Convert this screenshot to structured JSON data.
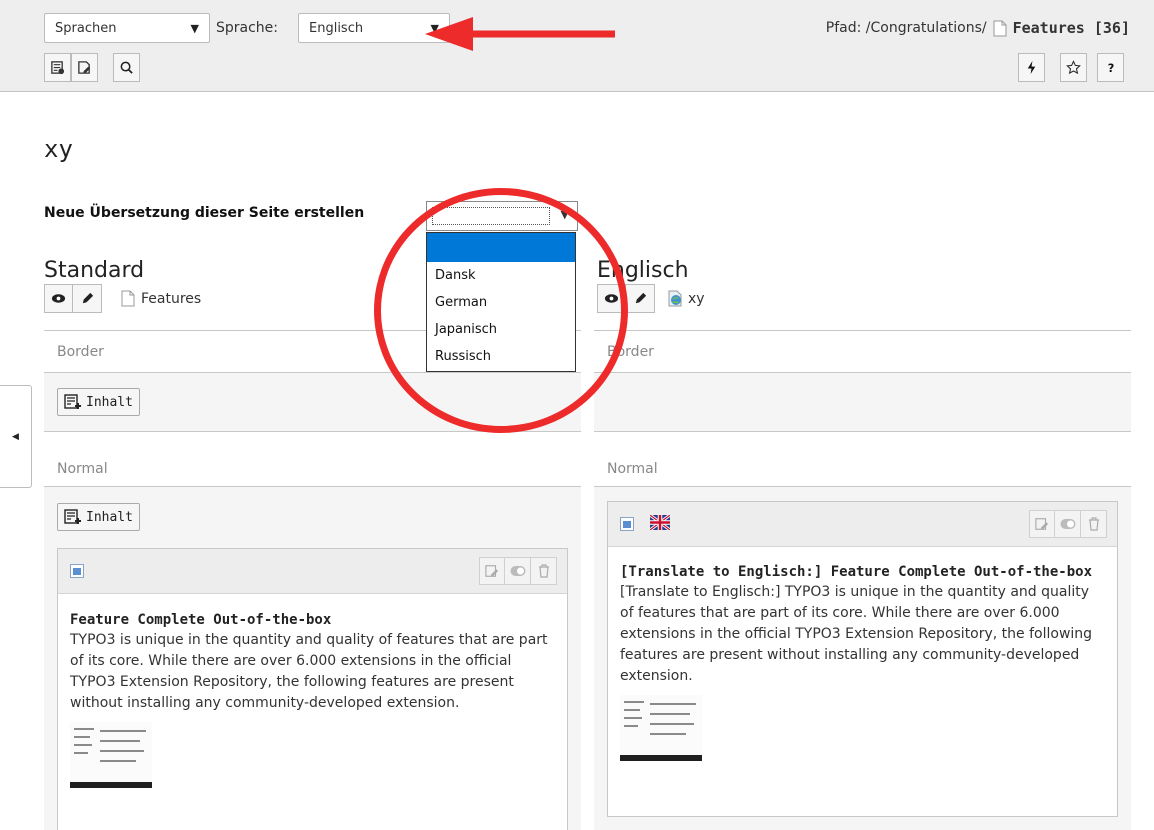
{
  "docheader": {
    "module_select": "Sprachen",
    "language_label": "Sprache:",
    "language_select": "Englisch",
    "path_label": "Pfad: /Congratulations/",
    "path_page": "Features [36]"
  },
  "page": {
    "title": "xy",
    "new_translation_label": "Neue Übersetzung dieser Seite erstellen",
    "new_translation_options": [
      "",
      "Dansk",
      "German",
      "Japanisch",
      "Russisch"
    ]
  },
  "columns": {
    "left": {
      "heading": "Standard",
      "page_name": "Features",
      "sections": {
        "border": "Border",
        "normal": "Normal"
      },
      "add_content": "Inhalt",
      "card": {
        "title": "Feature Complete Out-of-the-box",
        "text": "TYPO3 is unique in the quantity and quality of features that are part of its core. While there are over 6.000 extensions in the official TYPO3 Extension Repository, the following features are present without installing any community-developed extension."
      }
    },
    "right": {
      "heading": "Englisch",
      "page_name": "xy",
      "sections": {
        "border": "Border",
        "normal": "Normal"
      },
      "card": {
        "title": "[Translate to Englisch:] Feature Complete Out-of-the-box",
        "text": "[Translate to Englisch:] TYPO3 is unique in the quantity and quality of features that are part of its core. While there are over 6.000 extensions in the official TYPO3 Extension Repository, the following features are present without installing any community-developed extension."
      }
    }
  },
  "colors": {
    "annotation": "#ee2b2b",
    "selected_option": "#0078d7",
    "header_bg": "#eeeeee"
  },
  "icons": [
    "chevron-down-icon",
    "page-icon",
    "clear-cache-icon",
    "edit-page-icon",
    "search-icon",
    "flash-icon",
    "star-icon",
    "help-icon",
    "eye-icon",
    "pencil-icon",
    "globe-page-icon",
    "add-content-icon",
    "content-element-icon",
    "flag-uk-icon",
    "edit-icon",
    "toggle-icon",
    "trash-icon",
    "chevron-left-icon"
  ]
}
